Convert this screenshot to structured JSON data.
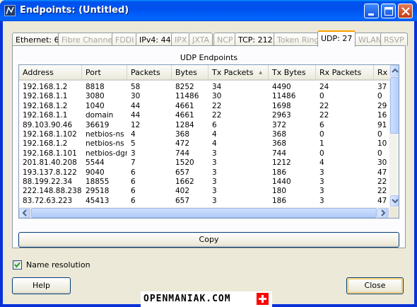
{
  "window": {
    "title": "Endpoints: (Untitled)"
  },
  "tabs": [
    {
      "label": "Ethernet: 6",
      "state": "enabled"
    },
    {
      "label": "Fibre Channel",
      "state": "disabled"
    },
    {
      "label": "FDDI",
      "state": "disabled"
    },
    {
      "label": "IPv4: 44",
      "state": "enabled"
    },
    {
      "label": "IPX",
      "state": "disabled"
    },
    {
      "label": "JXTA",
      "state": "disabled"
    },
    {
      "label": "NCP",
      "state": "disabled"
    },
    {
      "label": "TCP: 212",
      "state": "enabled"
    },
    {
      "label": "Token Ring",
      "state": "disabled"
    },
    {
      "label": "UDP: 27",
      "state": "active"
    },
    {
      "label": "WLAN",
      "state": "disabled"
    },
    {
      "label": "RSVP",
      "state": "disabled"
    }
  ],
  "panel": {
    "title": "UDP Endpoints"
  },
  "table": {
    "columns": [
      "Address",
      "Port",
      "Packets",
      "Bytes",
      "Tx Packets",
      "Tx Bytes",
      "Rx Packets",
      "Rx"
    ],
    "sorted_column": "Tx Packets",
    "rows": [
      [
        "192.168.1.2",
        "8818",
        "58",
        "8252",
        "34",
        "4490",
        "24",
        "37"
      ],
      [
        "192.168.1.1",
        "3080",
        "30",
        "11486",
        "30",
        "11486",
        "0",
        "0"
      ],
      [
        "192.168.1.2",
        "1040",
        "44",
        "4661",
        "22",
        "1698",
        "22",
        "29"
      ],
      [
        "192.168.1.1",
        "domain",
        "44",
        "4661",
        "22",
        "2963",
        "22",
        "16"
      ],
      [
        "89.103.90.46",
        "36619",
        "12",
        "1284",
        "6",
        "372",
        "6",
        "91"
      ],
      [
        "192.168.1.102",
        "netbios-ns",
        "4",
        "368",
        "4",
        "368",
        "0",
        "0"
      ],
      [
        "192.168.1.2",
        "netbios-ns",
        "5",
        "472",
        "4",
        "368",
        "1",
        "10"
      ],
      [
        "192.168.1.101",
        "netbios-dgm",
        "3",
        "744",
        "3",
        "744",
        "0",
        "0"
      ],
      [
        "201.81.40.208",
        "5544",
        "7",
        "1520",
        "3",
        "1212",
        "4",
        "30"
      ],
      [
        "193.137.8.122",
        "9040",
        "6",
        "657",
        "3",
        "186",
        "3",
        "47"
      ],
      [
        "88.199.22.34",
        "18855",
        "6",
        "1662",
        "3",
        "1440",
        "3",
        "22"
      ],
      [
        "222.148.88.238",
        "29518",
        "6",
        "402",
        "3",
        "180",
        "3",
        "22"
      ],
      [
        "83.72.63.223",
        "45413",
        "6",
        "657",
        "3",
        "186",
        "3",
        "47"
      ]
    ]
  },
  "buttons": {
    "copy": "Copy",
    "help": "Help",
    "close": "Close"
  },
  "options": {
    "name_resolution_label": "Name resolution",
    "name_resolution_checked": true
  },
  "watermark": {
    "text": "OPENMANIAK.COM"
  },
  "icons": {
    "app": "wireshark-icon",
    "minimize": "minimize-icon",
    "maximize": "maximize-icon",
    "close": "close-icon",
    "sort": "sort-ascending-icon",
    "check": "checkmark-icon",
    "flag": "swiss-flag-icon"
  },
  "colors": {
    "titlebar": "#0054e3",
    "active_tab_accent": "#ff9c00",
    "window_face": "#ece9d8"
  }
}
